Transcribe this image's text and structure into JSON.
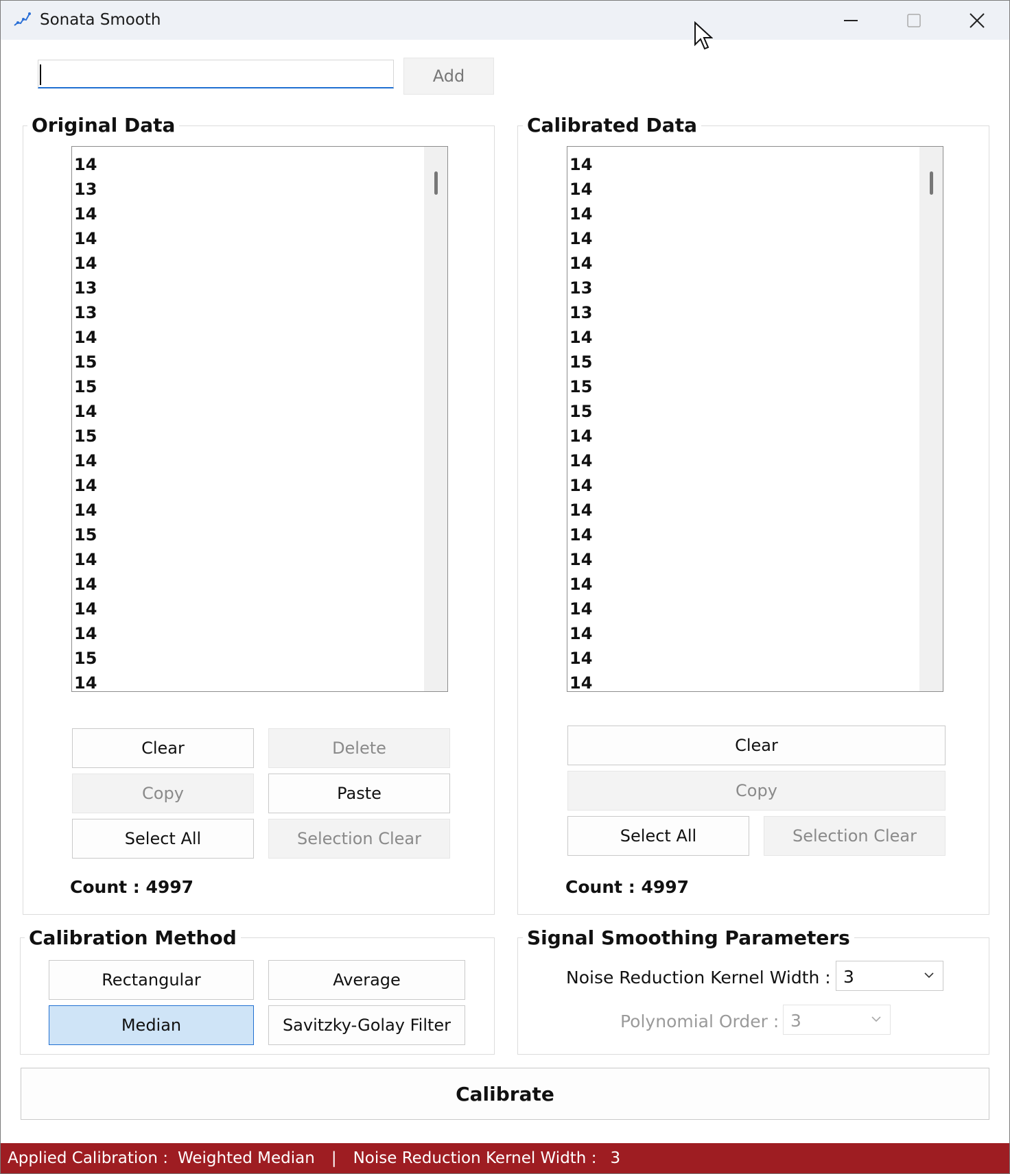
{
  "window": {
    "title": "Sonata Smooth"
  },
  "input": {
    "value": "",
    "placeholder": ""
  },
  "add_label": "Add",
  "original": {
    "title": "Original Data",
    "items": [
      "14",
      "13",
      "14",
      "14",
      "14",
      "13",
      "13",
      "14",
      "15",
      "15",
      "14",
      "15",
      "14",
      "14",
      "14",
      "15",
      "14",
      "14",
      "14",
      "14",
      "15",
      "14"
    ],
    "buttons": {
      "clear": "Clear",
      "delete": "Delete",
      "copy": "Copy",
      "paste": "Paste",
      "select_all": "Select All",
      "selection_clear": "Selection Clear"
    },
    "count_label": "Count : 4997"
  },
  "calibrated": {
    "title": "Calibrated Data",
    "items": [
      "14",
      "14",
      "14",
      "14",
      "14",
      "13",
      "13",
      "14",
      "15",
      "15",
      "15",
      "14",
      "14",
      "14",
      "14",
      "14",
      "14",
      "14",
      "14",
      "14",
      "14",
      "14"
    ],
    "buttons": {
      "clear": "Clear",
      "copy": "Copy",
      "select_all": "Select All",
      "selection_clear": "Selection Clear"
    },
    "count_label": "Count : 4997"
  },
  "method": {
    "title": "Calibration Method",
    "rectangular": "Rectangular",
    "average": "Average",
    "median": "Median",
    "savitzky": "Savitzky-Golay Filter",
    "selected": "Median"
  },
  "params": {
    "title": "Signal Smoothing Parameters",
    "kernel_label": "Noise Reduction Kernel Width :",
    "kernel_value": "3",
    "poly_label": "Polynomial Order :",
    "poly_value": "3"
  },
  "calibrate_label": "Calibrate",
  "status": {
    "applied_label": "Applied Calibration :",
    "applied_value": "Weighted Median",
    "separator": "|",
    "kernel_label": "Noise Reduction Kernel Width :",
    "kernel_value": "3"
  },
  "colors": {
    "status_bar": "#9e1d22",
    "accent": "#1f6fd1",
    "selected_fill": "#cfe4f7"
  }
}
